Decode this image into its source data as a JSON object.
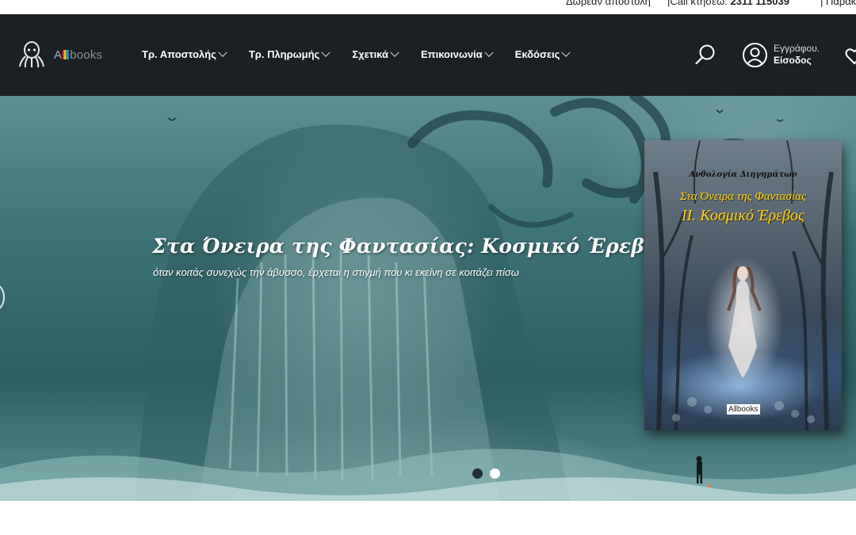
{
  "topbar": {
    "free_shipping": "Δωρεάν αποστολή",
    "call_label": "|Call κτήσεω:",
    "call_number": "2311 115039",
    "track": "|  Παρακο"
  },
  "nav": {
    "brand_prefix": "A",
    "brand_suffix": "books",
    "menu": [
      {
        "label": "Τρ. Αποστολής"
      },
      {
        "label": "Τρ. Πληρωμής"
      },
      {
        "label": "Σχετικά"
      },
      {
        "label": "Επικοινωνία"
      },
      {
        "label": "Εκδόσεις"
      }
    ],
    "login_line1": "Εγγράφου.",
    "login_line2": "Είσοδος"
  },
  "hero": {
    "title": "Στα Όνειρα της Φαντασίας: Κοσμικό Έρεβος",
    "subtitle": "όταν κοιτάς συνεχώς την άβυσσο, έρχεται η στιγμή που κι εκείνη σε κοιτάζει πίσω",
    "slide_count": 2,
    "active_slide": 2
  },
  "book": {
    "anthology": "Ανθολογία Διηγημάτων",
    "title_line1": "Στα Όνειρα της Φαντασίας",
    "title_line2": "ΙΙ. Κοσμικό Έρεβος",
    "publisher": "A‖books"
  },
  "colors": {
    "nav_bg": "#1b2025",
    "book_title": "#ffd21f",
    "dot_active": "#ffffff",
    "dot_inactive": "#1f2f33"
  },
  "icons": {
    "logo": "octopus-logo-icon",
    "search": "search-icon",
    "user": "user-icon",
    "wishlist": "heart-icon",
    "menu_chevron": "chevron-down-icon"
  }
}
